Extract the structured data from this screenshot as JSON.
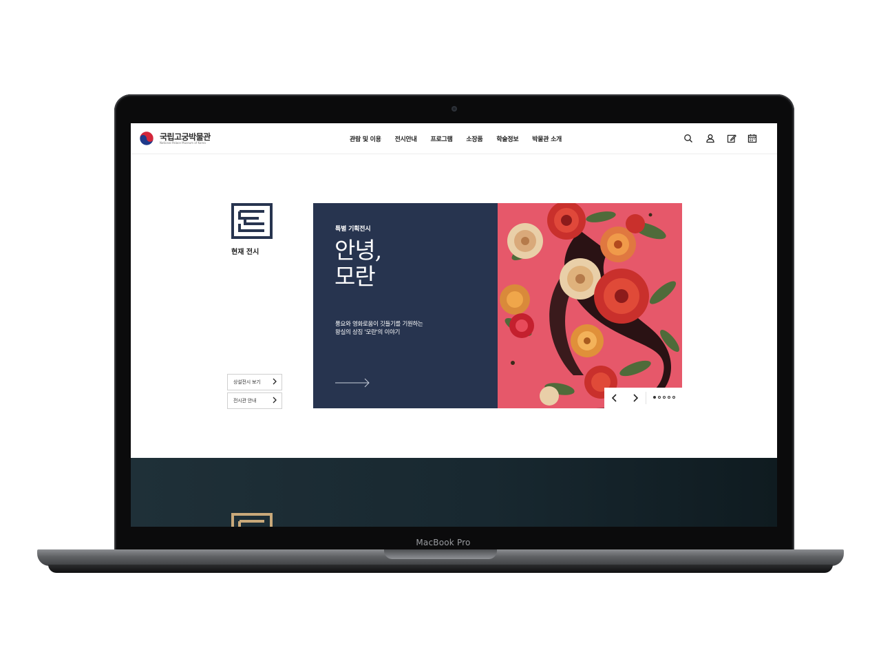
{
  "device": {
    "label": "MacBook Pro"
  },
  "header": {
    "logo_ko": "국립고궁박물관",
    "logo_en": "National Palace Museum of Korea",
    "menu": [
      {
        "label": "관람 및 이용"
      },
      {
        "label": "전시안내"
      },
      {
        "label": "프로그램"
      },
      {
        "label": "소장품"
      },
      {
        "label": "학술정보"
      },
      {
        "label": "박물관 소개"
      }
    ],
    "utility_icons": [
      "search-icon",
      "user-icon",
      "edit-icon",
      "calendar-icon"
    ]
  },
  "section": {
    "title": "현재 전시",
    "buttons": [
      {
        "label": "상설전시 보기"
      },
      {
        "label": "전시관 안내"
      }
    ]
  },
  "hero": {
    "kicker": "특별 기획전시",
    "title": "안녕,\n모란",
    "description": "풍요와 영화로움이 깃들기를 기원하는\n왕실의 상징 '모란'의 이야기",
    "slides_total": 5,
    "slide_active": 1
  },
  "colors": {
    "navy": "#27344f",
    "pink": "#e6586a",
    "band": "#1f3038",
    "gold": "#c9a97a"
  }
}
